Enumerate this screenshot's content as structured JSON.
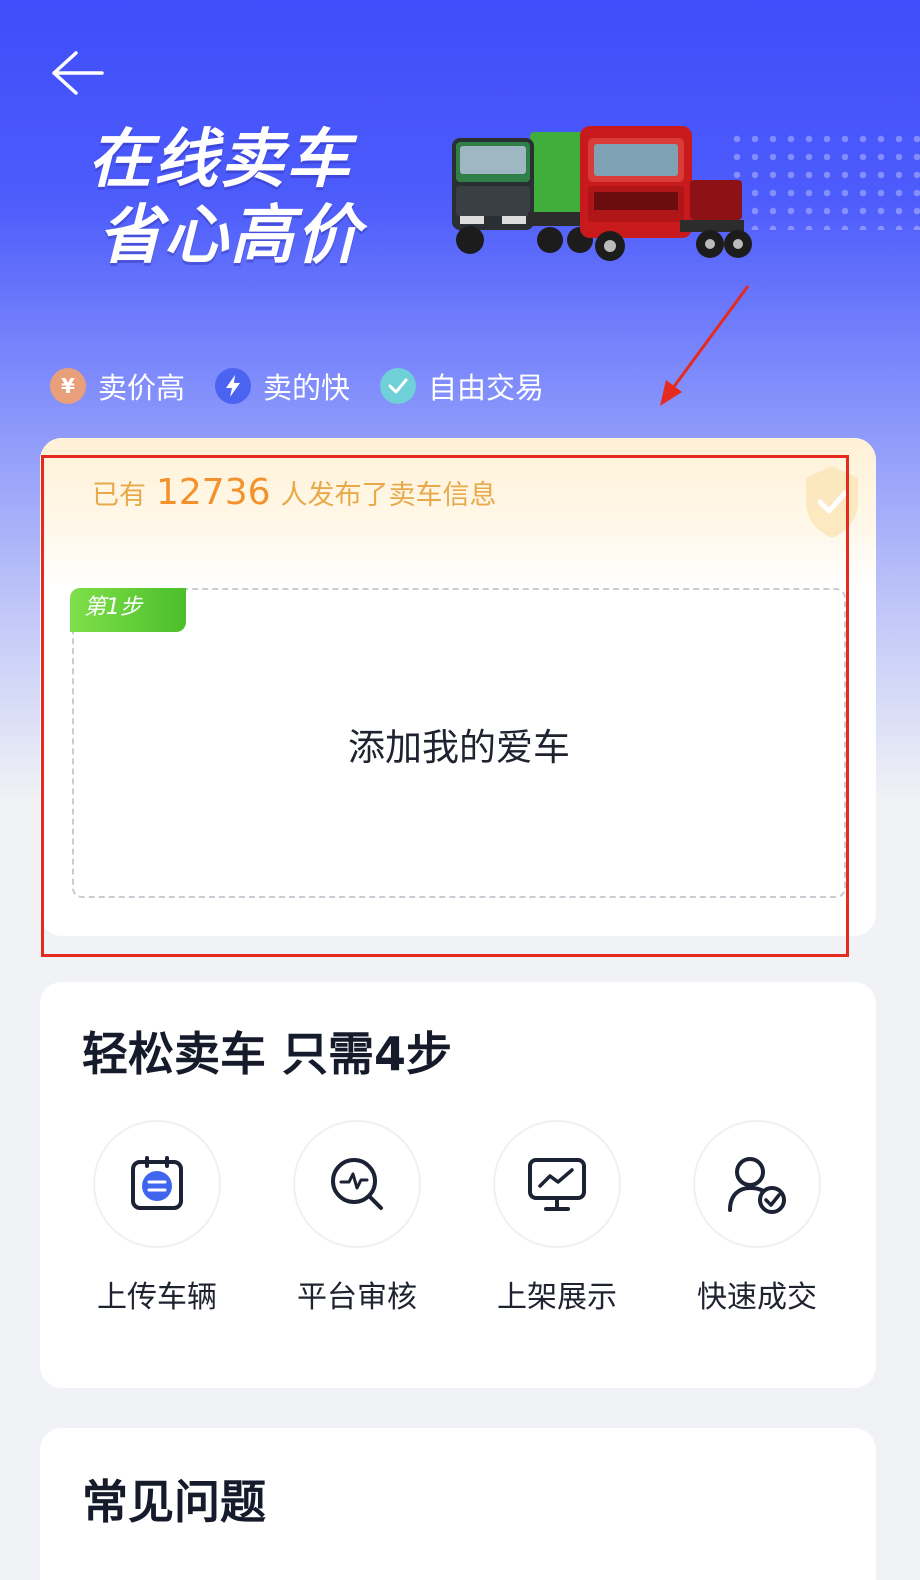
{
  "header": {
    "slogan_line1": "在线卖车",
    "slogan_line2": "省心高价"
  },
  "features": [
    {
      "icon": "yen-icon",
      "glyph": "¥",
      "color": "#e9a07a",
      "label": "卖价高"
    },
    {
      "icon": "lightning-icon",
      "glyph": "⚡",
      "color": "#4a63f0",
      "label": "卖的快"
    },
    {
      "icon": "check-icon",
      "glyph": "✓",
      "color": "#6fd0d8",
      "label": "自由交易"
    }
  ],
  "publish": {
    "prefix": "已有",
    "count": "12736",
    "suffix": "人发布了卖车信息"
  },
  "step1": {
    "tag": "第1步",
    "action": "添加我的爱车"
  },
  "process": {
    "title": "轻松卖车 只需4步",
    "steps": [
      {
        "icon": "upload-document-icon",
        "label": "上传车辆"
      },
      {
        "icon": "review-search-icon",
        "label": "平台审核"
      },
      {
        "icon": "display-monitor-icon",
        "label": "上架展示"
      },
      {
        "icon": "user-check-icon",
        "label": "快速成交"
      }
    ]
  },
  "faq": {
    "title": "常见问题"
  },
  "colors": {
    "brand_blue": "#3f4dfa",
    "highlight_orange": "#f3922d",
    "annotation_red": "#e52a20",
    "step_green": "#4bbf2a"
  }
}
